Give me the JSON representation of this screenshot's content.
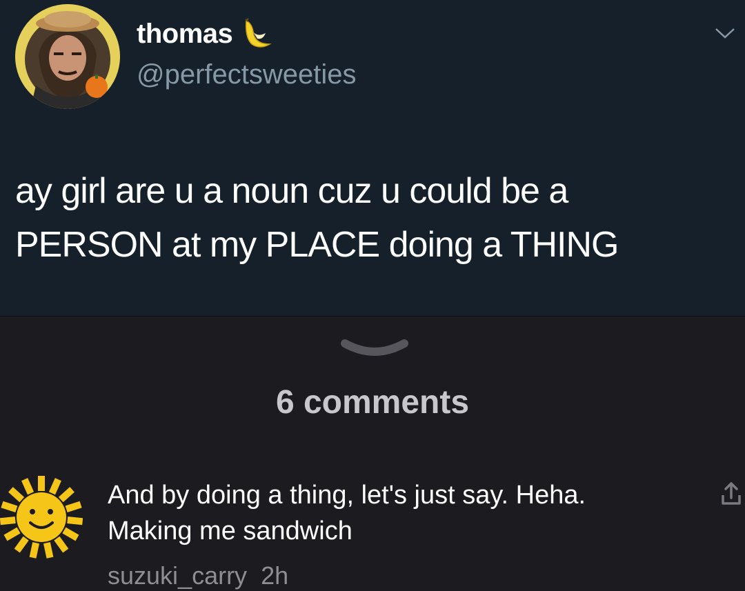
{
  "tweet": {
    "display_name": "thomas",
    "name_emoji": "banana",
    "handle": "@perfectsweeties",
    "text_line1": "ay girl are u a noun cuz u could be a",
    "text_line2": "PERSON at my PLACE doing a THING"
  },
  "comments": {
    "count_label": "6 comments",
    "items": [
      {
        "text_line1": "And by doing a thing, let's just say. Heha.",
        "text_line2": "Making me sandwich",
        "username": "suzuki_carry",
        "time": "2h"
      }
    ]
  },
  "icons": {
    "tweet_menu": "chevron-down-icon",
    "collapse": "collapse-chevron-icon",
    "share": "share-icon"
  },
  "colors": {
    "tweet_bg": "#15202b",
    "page_bg": "#1c1b20",
    "handle": "#8899a6",
    "comment_meta": "#8e8e93",
    "avatar_ring": "#e4d05a",
    "sun_yellow": "#f5c518"
  }
}
